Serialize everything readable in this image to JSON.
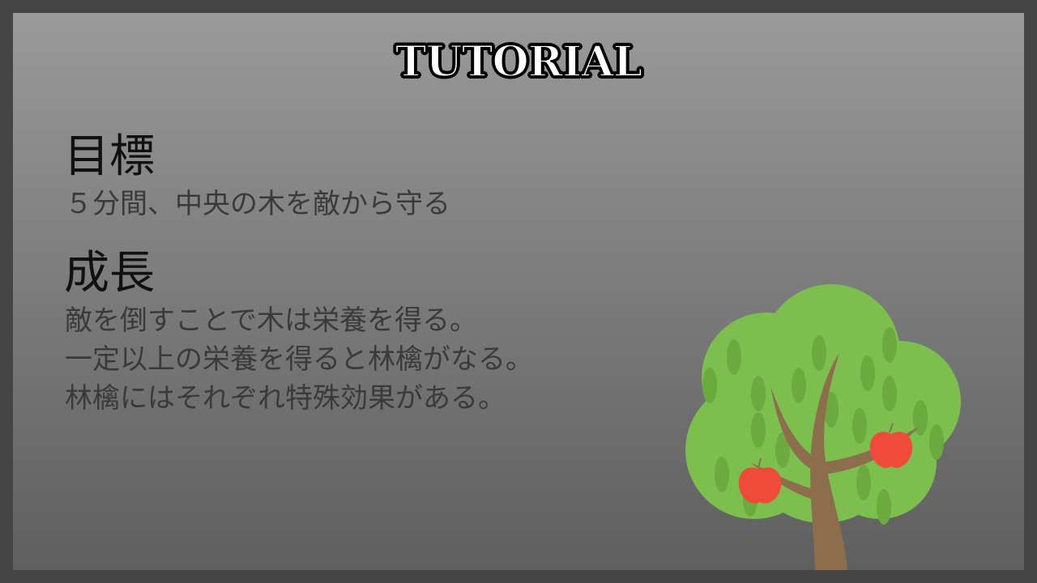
{
  "title": "TUTORIAL",
  "goal": {
    "heading": "目標",
    "text": "５分間、中央の木を敵から守る"
  },
  "growth": {
    "heading": "成長",
    "lines": [
      "敵を倒すことで木は栄養を得る。",
      "一定以上の栄養を得ると林檎がなる。",
      "林檎にはそれぞれ特殊効果がある。"
    ]
  },
  "colors": {
    "background": "#444444",
    "foliage": "#7dbf4e",
    "leaf": "#6aaa3e",
    "trunk": "#8d6e4c",
    "apple": "#f04a3a"
  },
  "icons": {
    "tree": "apple-tree-illustration"
  }
}
